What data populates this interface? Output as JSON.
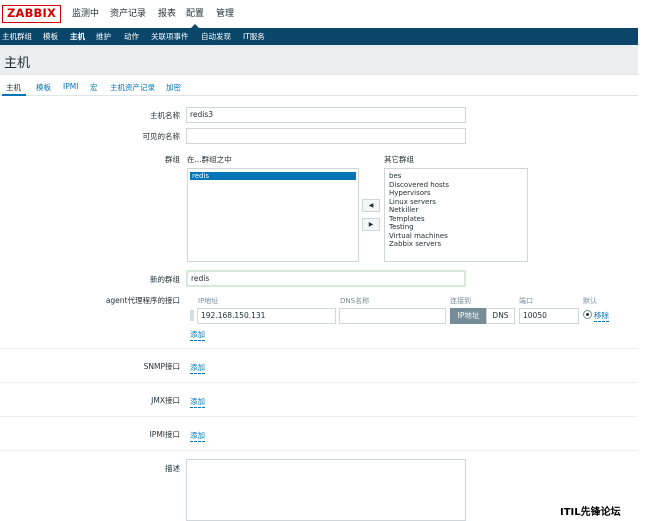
{
  "top_nav": {
    "logo": "ZABBIX",
    "menu": [
      "监测中",
      "资产记录",
      "报表",
      "配置",
      "管理"
    ]
  },
  "sub_nav": [
    "主机群组",
    "模板",
    "主机",
    "维护",
    "动作",
    "关联项事件",
    "自动发现",
    "IT服务"
  ],
  "page_title": "主机",
  "tabs": [
    "主机",
    "模板",
    "IPMI",
    "宏",
    "主机资产记录",
    "加密"
  ],
  "form": {
    "host_name": {
      "label": "主机名称",
      "value": "redis3"
    },
    "visible_name": {
      "label": "可见的名称",
      "value": ""
    },
    "groups": {
      "label": "群组",
      "in_groups_label": "在...群组之中",
      "other_groups_label": "其它群组",
      "in_groups": [
        "redis"
      ],
      "other_groups": [
        "bes",
        "Discovered hosts",
        "Hypervisors",
        "Linux servers",
        "Netkiller",
        "Templates",
        "Testing",
        "Virtual machines",
        "Zabbix servers"
      ],
      "move_left": "◀",
      "move_right": "▶"
    },
    "new_group": {
      "label": "新的群组",
      "value": "redis"
    },
    "agent_interfaces": {
      "label": "agent代理程序的接口",
      "columns": {
        "ip": "IP地址",
        "dns": "DNS名称",
        "connect_to": "连接到",
        "port": "端口",
        "default": "默认"
      },
      "row": {
        "ip": "192.168.150.131",
        "dns": "",
        "connect_ip": "IP地址",
        "connect_dns": "DNS",
        "port": "10050",
        "remove": "移除"
      },
      "add": "添加"
    },
    "snmp": {
      "label": "SNMP接口",
      "add": "添加"
    },
    "jmx": {
      "label": "JMX接口",
      "add": "添加"
    },
    "ipmi": {
      "label": "IPMI接口",
      "add": "添加"
    },
    "description": {
      "label": "描述",
      "value": ""
    }
  },
  "watermark": "ITIL先锋论坛",
  "colors": {
    "logo_red": "#d40000",
    "nav_blue": "#0a466a",
    "link_blue": "#0275b8",
    "highlight_green": "#d6eadb"
  }
}
